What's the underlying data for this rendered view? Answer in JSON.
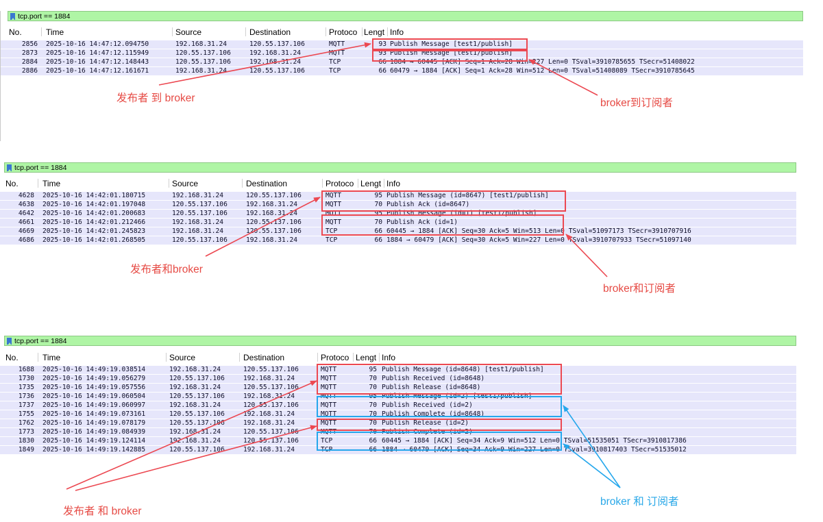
{
  "colors": {
    "filter_bar": "#aff5a5",
    "row_bg": "#e6e6fb",
    "highlight_red": "#ec4851",
    "highlight_blue": "#25a7ec",
    "annotation_red": "#e64a44",
    "annotation_blue": "#2aa8e8"
  },
  "columns": {
    "no": "No.",
    "time": "Time",
    "source": "Source",
    "destination": "Destination",
    "protocol": "Protoco",
    "length": "Lengt",
    "info": "Info"
  },
  "panels": [
    {
      "filter": "tcp.port == 1884",
      "rows": [
        {
          "no": "2856",
          "time": "2025-10-16 14:47:12.094750",
          "src": "192.168.31.24",
          "dst": "120.55.137.106",
          "proto": "MQTT",
          "len": "93",
          "info": "Publish Message [test1/publish]"
        },
        {
          "no": "2873",
          "time": "2025-10-16 14:47:12.115949",
          "src": "120.55.137.106",
          "dst": "192.168.31.24",
          "proto": "MQTT",
          "len": "93",
          "info": "Publish Message [test1/publish]"
        },
        {
          "no": "2884",
          "time": "2025-10-16 14:47:12.148443",
          "src": "120.55.137.106",
          "dst": "192.168.31.24",
          "proto": "TCP",
          "len": "66",
          "info": "1884 → 60445 [ACK] Seq=1 Ack=28 Win=227 Len=0 TSval=3910785655 TSecr=51408022"
        },
        {
          "no": "2886",
          "time": "2025-10-16 14:47:12.161671",
          "src": "192.168.31.24",
          "dst": "120.55.137.106",
          "proto": "TCP",
          "len": "66",
          "info": "60479 → 1884 [ACK] Seq=1 Ack=28 Win=512 Len=0 TSval=51408089 TSecr=3910785645"
        }
      ],
      "annotations": {
        "left": "发布者 到 broker",
        "right": "broker到订阅者"
      }
    },
    {
      "filter": "tcp.port == 1884",
      "rows": [
        {
          "no": "4628",
          "time": "2025-10-16 14:42:01.180715",
          "src": "192.168.31.24",
          "dst": "120.55.137.106",
          "proto": "MQTT",
          "len": "95",
          "info": "Publish Message (id=8647) [test1/publish]"
        },
        {
          "no": "4638",
          "time": "2025-10-16 14:42:01.197048",
          "src": "120.55.137.106",
          "dst": "192.168.31.24",
          "proto": "MQTT",
          "len": "70",
          "info": "Publish Ack (id=8647)"
        },
        {
          "no": "4642",
          "time": "2025-10-16 14:42:01.200683",
          "src": "120.55.137.106",
          "dst": "192.168.31.24",
          "proto": "MQTT",
          "len": "95",
          "info": "Publish Message (id=1) [test1/publish]"
        },
        {
          "no": "4661",
          "time": "2025-10-16 14:42:01.212466",
          "src": "192.168.31.24",
          "dst": "120.55.137.106",
          "proto": "MQTT",
          "len": "70",
          "info": "Publish Ack (id=1)"
        },
        {
          "no": "4669",
          "time": "2025-10-16 14:42:01.245823",
          "src": "192.168.31.24",
          "dst": "120.55.137.106",
          "proto": "TCP",
          "len": "66",
          "info": "60445 → 1884 [ACK] Seq=30 Ack=5 Win=513 Len=0 TSval=51097173 TSecr=3910707916"
        },
        {
          "no": "4686",
          "time": "2025-10-16 14:42:01.268505",
          "src": "120.55.137.106",
          "dst": "192.168.31.24",
          "proto": "TCP",
          "len": "66",
          "info": "1884 → 60479 [ACK] Seq=30 Ack=5 Win=227 Len=0 TSval=3910707933 TSecr=51097140"
        }
      ],
      "annotations": {
        "left": "发布者和broker",
        "right": "broker和订阅者"
      }
    },
    {
      "filter": "tcp.port == 1884",
      "rows": [
        {
          "no": "1688",
          "time": "2025-10-16 14:49:19.038514",
          "src": "192.168.31.24",
          "dst": "120.55.137.106",
          "proto": "MQTT",
          "len": "95",
          "info": "Publish Message (id=8648) [test1/publish]"
        },
        {
          "no": "1730",
          "time": "2025-10-16 14:49:19.056279",
          "src": "120.55.137.106",
          "dst": "192.168.31.24",
          "proto": "MQTT",
          "len": "70",
          "info": "Publish Received (id=8648)"
        },
        {
          "no": "1735",
          "time": "2025-10-16 14:49:19.057556",
          "src": "192.168.31.24",
          "dst": "120.55.137.106",
          "proto": "MQTT",
          "len": "70",
          "info": "Publish Release (id=8648)"
        },
        {
          "no": "1736",
          "time": "2025-10-16 14:49:19.060504",
          "src": "120.55.137.106",
          "dst": "192.168.31.24",
          "proto": "MQTT",
          "len": "95",
          "info": "Publish Message (id=2) [test1/publish]"
        },
        {
          "no": "1737",
          "time": "2025-10-16 14:49:19.060997",
          "src": "192.168.31.24",
          "dst": "120.55.137.106",
          "proto": "MQTT",
          "len": "70",
          "info": "Publish Received (id=2)"
        },
        {
          "no": "1755",
          "time": "2025-10-16 14:49:19.073161",
          "src": "120.55.137.106",
          "dst": "192.168.31.24",
          "proto": "MQTT",
          "len": "70",
          "info": "Publish Complete (id=8648)"
        },
        {
          "no": "1762",
          "time": "2025-10-16 14:49:19.078179",
          "src": "120.55.137.106",
          "dst": "192.168.31.24",
          "proto": "MQTT",
          "len": "70",
          "info": "Publish Release (id=2)"
        },
        {
          "no": "1773",
          "time": "2025-10-16 14:49:19.084939",
          "src": "192.168.31.24",
          "dst": "120.55.137.106",
          "proto": "MQTT",
          "len": "70",
          "info": "Publish Complete (id=2)"
        },
        {
          "no": "1830",
          "time": "2025-10-16 14:49:19.124114",
          "src": "192.168.31.24",
          "dst": "120.55.137.106",
          "proto": "TCP",
          "len": "66",
          "info": "60445 → 1884 [ACK] Seq=34 Ack=9 Win=512 Len=0 TSval=51535051 TSecr=3910817386"
        },
        {
          "no": "1849",
          "time": "2025-10-16 14:49:19.142885",
          "src": "120.55.137.106",
          "dst": "192.168.31.24",
          "proto": "TCP",
          "len": "66",
          "info": "1884 → 60479 [ACK] Seq=34 Ack=9 Win=227 Len=0 TSval=3910817403 TSecr=51535012"
        }
      ],
      "annotations": {
        "left": "发布者 和 broker",
        "right": "broker 和 订阅者"
      }
    }
  ]
}
